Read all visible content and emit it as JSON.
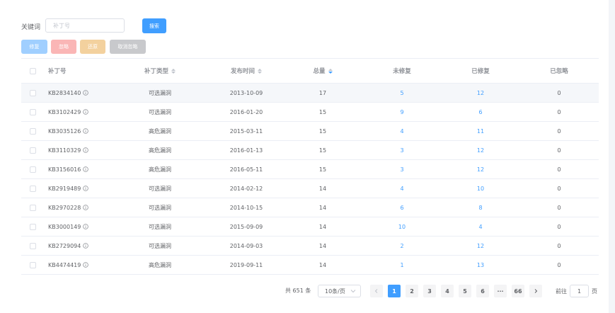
{
  "search": {
    "label": "关键词",
    "placeholder": "补丁号",
    "button_label": "搜索"
  },
  "actions": {
    "fix": "修复",
    "ignore": "忽略",
    "restore": "还原",
    "cancel_ignore": "取消忽略"
  },
  "table": {
    "headers": {
      "patch": "补丁号",
      "type": "补丁类型",
      "date": "发布时间",
      "total": "总量",
      "unfixed": "未修复",
      "fixed": "已修复",
      "ignored": "已忽略"
    },
    "rows": [
      {
        "patch": "KB2834140",
        "type": "可选漏洞",
        "date": "2013-10-09",
        "total": "17",
        "unfixed": "5",
        "fixed": "12",
        "ignored": "0"
      },
      {
        "patch": "KB3102429",
        "type": "可选漏洞",
        "date": "2016-01-20",
        "total": "15",
        "unfixed": "9",
        "fixed": "6",
        "ignored": "0"
      },
      {
        "patch": "KB3035126",
        "type": "高危漏洞",
        "date": "2015-03-11",
        "total": "15",
        "unfixed": "4",
        "fixed": "11",
        "ignored": "0"
      },
      {
        "patch": "KB3110329",
        "type": "高危漏洞",
        "date": "2016-01-13",
        "total": "15",
        "unfixed": "3",
        "fixed": "12",
        "ignored": "0"
      },
      {
        "patch": "KB3156016",
        "type": "高危漏洞",
        "date": "2016-05-11",
        "total": "15",
        "unfixed": "3",
        "fixed": "12",
        "ignored": "0"
      },
      {
        "patch": "KB2919489",
        "type": "可选漏洞",
        "date": "2014-02-12",
        "total": "14",
        "unfixed": "4",
        "fixed": "10",
        "ignored": "0"
      },
      {
        "patch": "KB2970228",
        "type": "可选漏洞",
        "date": "2014-10-15",
        "total": "14",
        "unfixed": "6",
        "fixed": "8",
        "ignored": "0"
      },
      {
        "patch": "KB3000149",
        "type": "可选漏洞",
        "date": "2015-09-09",
        "total": "14",
        "unfixed": "10",
        "fixed": "4",
        "ignored": "0"
      },
      {
        "patch": "KB2729094",
        "type": "可选漏洞",
        "date": "2014-09-03",
        "total": "14",
        "unfixed": "2",
        "fixed": "12",
        "ignored": "0"
      },
      {
        "patch": "KB4474419",
        "type": "高危漏洞",
        "date": "2019-09-11",
        "total": "14",
        "unfixed": "1",
        "fixed": "13",
        "ignored": "0"
      }
    ]
  },
  "pagination": {
    "total": "共 651 条",
    "page_size": "10条/页",
    "pages": [
      "1",
      "2",
      "3",
      "4",
      "5",
      "6",
      "···",
      "66"
    ],
    "current": "1",
    "goto_label": "前往",
    "goto_value": "1",
    "goto_suffix": "页"
  },
  "colors": {
    "primary": "#409eff",
    "danger_light": "#fab6b6",
    "warning_light": "#f3d19e",
    "info_light": "#c8c9cc"
  }
}
